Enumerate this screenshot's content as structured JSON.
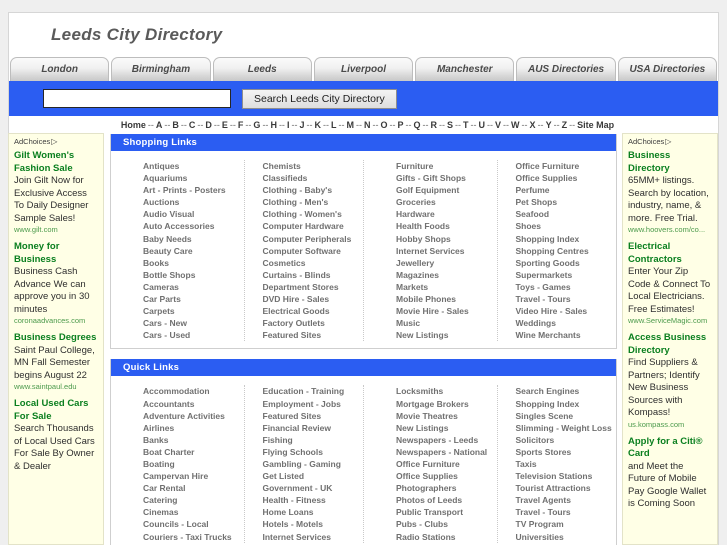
{
  "site": {
    "title": "Leeds City Directory"
  },
  "tabs": [
    {
      "label": "London"
    },
    {
      "label": "Birmingham"
    },
    {
      "label": "Leeds"
    },
    {
      "label": "Liverpool"
    },
    {
      "label": "Manchester"
    },
    {
      "label": "AUS Directories"
    },
    {
      "label": "USA Directories"
    }
  ],
  "search": {
    "value": "",
    "placeholder": "",
    "button_label": "Search Leeds City Directory"
  },
  "azbar": {
    "items": [
      "Home",
      "A",
      "B",
      "C",
      "D",
      "E",
      "F",
      "G",
      "H",
      "I",
      "J",
      "K",
      "L",
      "M",
      "N",
      "O",
      "P",
      "Q",
      "R",
      "S",
      "T",
      "U",
      "V",
      "W",
      "X",
      "Y",
      "Z",
      "Site Map"
    ],
    "separator": "--"
  },
  "ads": {
    "adchoices_label": "AdChoices",
    "adchoices_glyph": "▷",
    "left": [
      {
        "title": "Gilt Women's Fashion Sale",
        "body": "Join Gilt Now for Exclusive Access To Daily Designer Sample Sales!",
        "url": "www.gilt.com"
      },
      {
        "title": "Money for Business",
        "body": "Business Cash Advance We can approve you in 30 minutes",
        "url": "coronaadvances.com"
      },
      {
        "title": "Business Degrees",
        "body": "Saint Paul College, MN Fall Semester begins August 22",
        "url": "www.saintpaul.edu"
      },
      {
        "title": "Local Used Cars For Sale",
        "body": "Search Thousands of Local Used Cars For Sale By Owner & Dealer",
        "url": ""
      }
    ],
    "right": [
      {
        "title": "Business Directory",
        "body": "65MM+ listings. Search by location, industry, name, & more. Free Trial.",
        "url": "www.hoovers.com/co..."
      },
      {
        "title": "Electrical Contractors",
        "body": "Enter Your Zip Code & Connect To Local Electricians. Free Estimates!",
        "url": "www.ServiceMagic.com"
      },
      {
        "title": "Access Business Directory",
        "body": "Find Suppliers & Partners; Identify New Business Sources with Kompass!",
        "url": "us.kompass.com"
      },
      {
        "title": "Apply for a Citi® Card",
        "body": "and Meet the Future of Mobile Pay Google Wallet is Coming Soon",
        "url": ""
      }
    ]
  },
  "panels": [
    {
      "heading": "Shopping Links",
      "columns": [
        [
          "Antiques",
          "Aquariums",
          "Art - Prints - Posters",
          "Auctions",
          "Audio Visual",
          "Auto Accessories",
          "Baby Needs",
          "Beauty Care",
          "Books",
          "Bottle Shops",
          "Cameras",
          "Car Parts",
          "Carpets",
          "Cars - New",
          "Cars - Used"
        ],
        [
          "Chemists",
          "Classifieds",
          "Clothing - Baby's",
          "Clothing - Men's",
          "Clothing - Women's",
          "Computer Hardware",
          "Computer Peripherals",
          "Computer Software",
          "Cosmetics",
          "Curtains - Blinds",
          "Department Stores",
          "DVD Hire - Sales",
          "Electrical Goods",
          "Factory Outlets",
          "Featured Sites"
        ],
        [
          "Furniture",
          "Gifts - Gift Shops",
          "Golf Equipment",
          "Groceries",
          "Hardware",
          "Health Foods",
          "Hobby Shops",
          "Internet Services",
          "Jewellery",
          "Magazines",
          "Markets",
          "Mobile Phones",
          "Movie Hire - Sales",
          "Music",
          "New Listings"
        ],
        [
          "Office Furniture",
          "Office Supplies",
          "Perfume",
          "Pet Shops",
          "Seafood",
          "Shoes",
          "Shopping Index",
          "Shopping Centres",
          "Sporting Goods",
          "Supermarkets",
          "Toys - Games",
          "Travel - Tours",
          "Video Hire - Sales",
          "Weddings",
          "Wine Merchants"
        ]
      ]
    },
    {
      "heading": "Quick Links",
      "columns": [
        [
          "Accommodation",
          "Accountants",
          "Adventure Activities",
          "Airlines",
          "Banks",
          "Boat Charter",
          "Boating",
          "Campervan Hire",
          "Car Rental",
          "Catering",
          "Cinemas",
          "Councils - Local",
          "Couriers - Taxi Trucks"
        ],
        [
          "Education - Training",
          "Employment - Jobs",
          "Featured Sites",
          "Financial Review",
          "Fishing",
          "Flying Schools",
          "Gambling - Gaming",
          "Get Listed",
          "Government - UK",
          "Health - Fitness",
          "Home Loans",
          "Hotels - Motels",
          "Internet Services"
        ],
        [
          "Locksmiths",
          "Mortgage Brokers",
          "Movie Theatres",
          "New Listings",
          "Newspapers - Leeds",
          "Newspapers - National",
          "Office Furniture",
          "Office Supplies",
          "Photographers",
          "Photos of Leeds",
          "Public Transport",
          "Pubs - Clubs",
          "Radio Stations"
        ],
        [
          "Search Engines",
          "Shopping Index",
          "Singles Scene",
          "Slimming - Weight Loss",
          "Solicitors",
          "Sports Stores",
          "Taxis",
          "Television Stations",
          "Tourist Attractions",
          "Travel Agents",
          "Travel - Tours",
          "TV Program",
          "Universities"
        ]
      ]
    }
  ],
  "colors": {
    "accent_blue": "#2b5df2",
    "ad_background": "#ffffe6",
    "ad_title_green": "#0a7f1f",
    "link_gray": "#707070"
  }
}
